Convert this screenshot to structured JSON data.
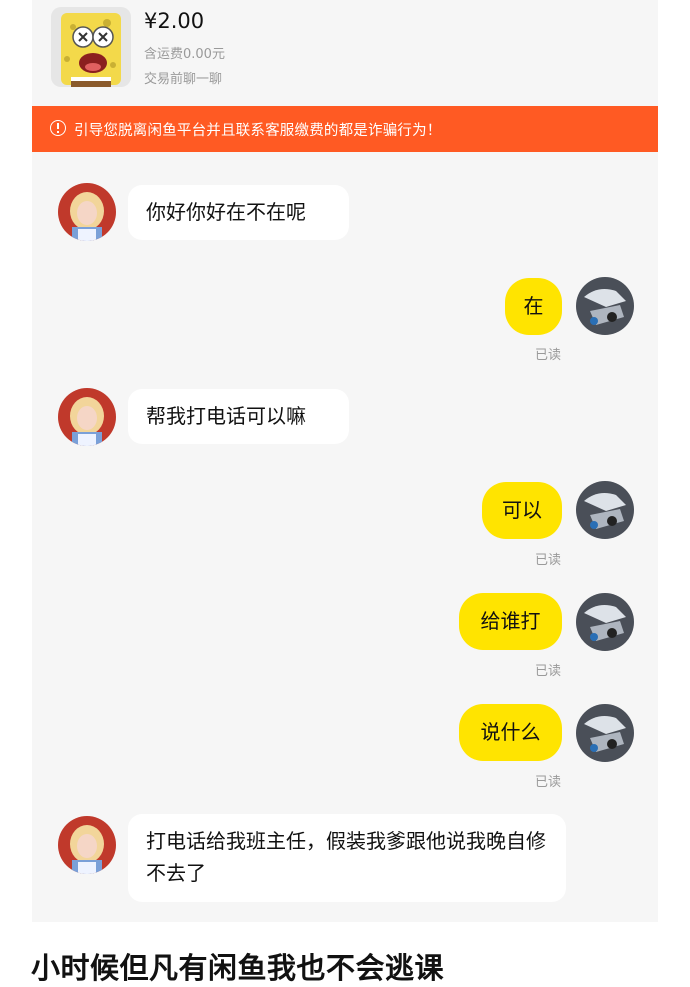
{
  "product": {
    "price": "¥2.00",
    "shipping": "含运费0.00元",
    "hint": "交易前聊一聊",
    "thumb_icon": "spongebob-icon"
  },
  "warning": {
    "text": "引导您脱离闲鱼平台并且联系客服缴费的都是诈骗行为！",
    "color": "#ff5a23"
  },
  "messages": [
    {
      "side": "in",
      "text": "你好你好在不在呢"
    },
    {
      "side": "out",
      "text": "在",
      "status": "已读"
    },
    {
      "side": "in",
      "text": "帮我打电话可以嘛"
    },
    {
      "side": "out",
      "text": "可以",
      "status": "已读"
    },
    {
      "side": "out",
      "text": "给谁打",
      "status": "已读"
    },
    {
      "side": "out",
      "text": "说什么",
      "status": "已读"
    },
    {
      "side": "in",
      "text": "打电话给我班主任，假装我爹跟他说我晚自修不去了"
    }
  ],
  "colors": {
    "outgoing_bubble": "#ffe400",
    "incoming_bubble": "#ffffff",
    "background": "#f6f6f6"
  },
  "caption": "小时候但凡有闲鱼我也不会逃课"
}
